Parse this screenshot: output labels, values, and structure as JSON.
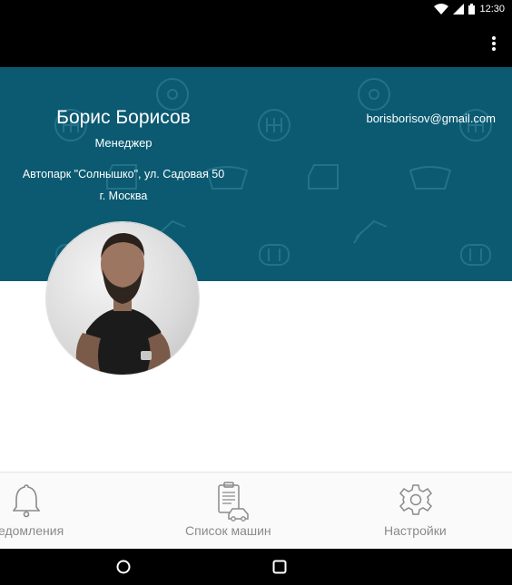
{
  "status_bar": {
    "time": "12:30"
  },
  "profile": {
    "name": "Борис Борисов",
    "role": "Менеджер",
    "address": "Автопарк \"Солнышко\", ул. Садовая 50",
    "city": "г. Москва",
    "email": "borisborisov@gmail.com"
  },
  "colors": {
    "header_bg": "#0b5a72",
    "app_bar": "#000000",
    "nav_inactive": "#8a8a8a"
  },
  "bottom_nav": {
    "items": [
      {
        "label": "едомления",
        "icon": "bell-icon"
      },
      {
        "label": "Список машин",
        "icon": "clipboard-car-icon"
      },
      {
        "label": "Настройки",
        "icon": "gear-icon"
      }
    ]
  },
  "system_nav": {
    "buttons": [
      "home-button",
      "recents-button"
    ]
  }
}
